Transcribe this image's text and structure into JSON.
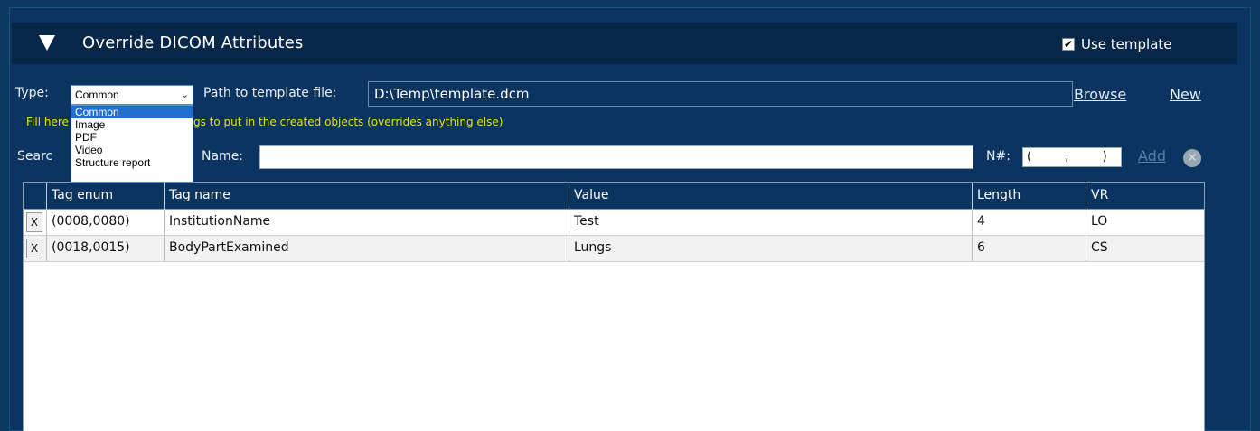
{
  "header": {
    "title": "Override DICOM Attributes",
    "use_template_label": "Use template",
    "use_template_checked": true
  },
  "controls": {
    "type_label": "Type:",
    "type_value": "Common",
    "type_options": [
      "Common",
      "Image",
      "PDF",
      "Video",
      "Structure report"
    ],
    "path_label": "Path to template file:",
    "path_value": "D:\\Temp\\template.dcm",
    "browse_label": "Browse",
    "new_label": "New",
    "hint_left": "Fill here",
    "hint_right": "gs to put in the created objects (overrides anything else)",
    "search_label": "Searc",
    "name_label": "Name:",
    "name_value": "",
    "n_label": "N#:",
    "n_value": "(         ,         )",
    "add_label": "Add"
  },
  "table": {
    "columns": [
      "Tag enum",
      "Tag name",
      "Value",
      "Length",
      "VR"
    ],
    "delete_label": "X",
    "rows": [
      {
        "tag_enum": "(0008,0080)",
        "tag_name": "InstitutionName",
        "value": "Test",
        "length": "4",
        "vr": "LO"
      },
      {
        "tag_enum": "(0018,0015)",
        "tag_name": "BodyPartExamined",
        "value": "Lungs",
        "length": "6",
        "vr": "CS"
      }
    ]
  },
  "colors": {
    "background": "#0b3560",
    "header_bar": "#062748",
    "hint_text": "#e8e000",
    "selection": "#1f6fd1"
  }
}
